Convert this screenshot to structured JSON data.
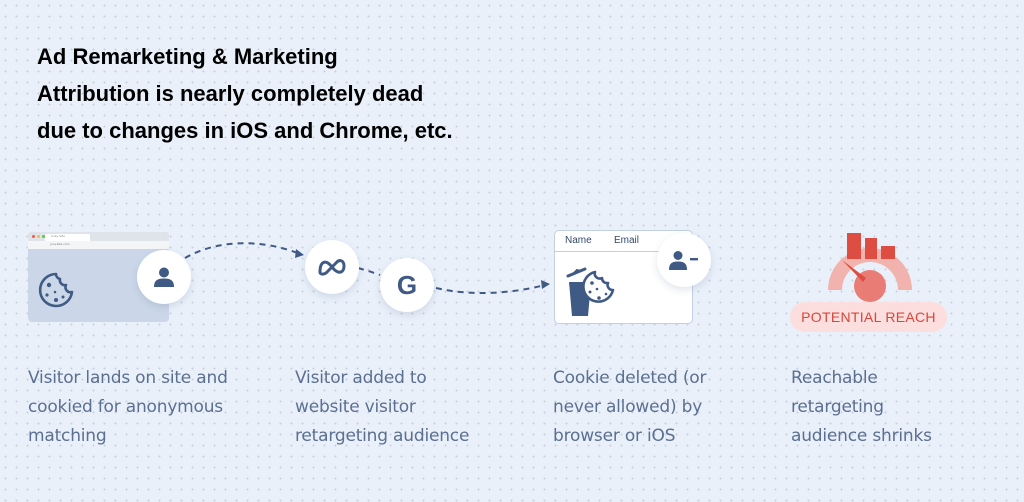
{
  "title": {
    "lines": [
      "Ad Remarketing & Marketing",
      "Attribution is nearly completely dead",
      "due to changes in iOS and Chrome, etc."
    ]
  },
  "colors": {
    "background": "#e9f0fa",
    "icon_navy": "#3f5a85",
    "caption_text": "#5b6f90",
    "reach_red": "#d9463c",
    "reach_pill_bg": "#fbdedd"
  },
  "steps": [
    {
      "icon": "browser-with-cookie-icon",
      "badge_icon": "user-icon",
      "caption": [
        "Visitor lands on site and",
        "cookied for anonymous",
        "matching"
      ]
    },
    {
      "icons": [
        "meta-logo-icon",
        "google-logo-icon"
      ],
      "google_letter": "G",
      "caption": [
        "Visitor added to",
        "website visitor",
        "retargeting audience"
      ]
    },
    {
      "icon": "trash-cookie-icon",
      "badge_icon": "remove-user-icon",
      "table_headers": [
        "Name",
        "Email"
      ],
      "caption": [
        "Cookie deleted (or",
        "never allowed) by",
        "browser or iOS"
      ]
    },
    {
      "icon": "gauge-chart-icon",
      "pill_label": "POTENTIAL REACH",
      "caption": [
        "Reachable",
        "retargeting",
        "audience shrinks"
      ]
    }
  ],
  "browser": {
    "tab_title": "Cozy Site",
    "url": "yoursite.com"
  }
}
